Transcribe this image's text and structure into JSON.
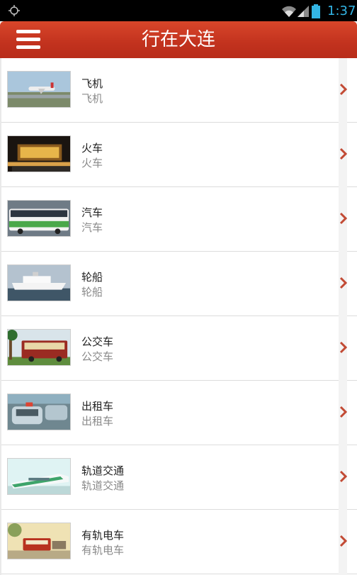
{
  "status_bar": {
    "time": "1:37"
  },
  "app_bar": {
    "title": "行在大连"
  },
  "colors": {
    "accent": "#c2321e",
    "status_icon": "#33b5e5",
    "chevron": "#c24a34"
  },
  "items": [
    {
      "title": "飞机",
      "subtitle": "飞机",
      "thumb_icon": "airplane-photo"
    },
    {
      "title": "火车",
      "subtitle": "火车",
      "thumb_icon": "train-station-photo"
    },
    {
      "title": "汽车",
      "subtitle": "汽车",
      "thumb_icon": "bus-photo"
    },
    {
      "title": "轮船",
      "subtitle": "轮船",
      "thumb_icon": "ship-photo"
    },
    {
      "title": "公交车",
      "subtitle": "公交车",
      "thumb_icon": "city-bus-photo"
    },
    {
      "title": "出租车",
      "subtitle": "出租车",
      "thumb_icon": "taxi-photo"
    },
    {
      "title": "轨道交通",
      "subtitle": "轨道交通",
      "thumb_icon": "rail-transit-photo"
    },
    {
      "title": "有轨电车",
      "subtitle": "有轨电车",
      "thumb_icon": "tram-photo"
    }
  ]
}
